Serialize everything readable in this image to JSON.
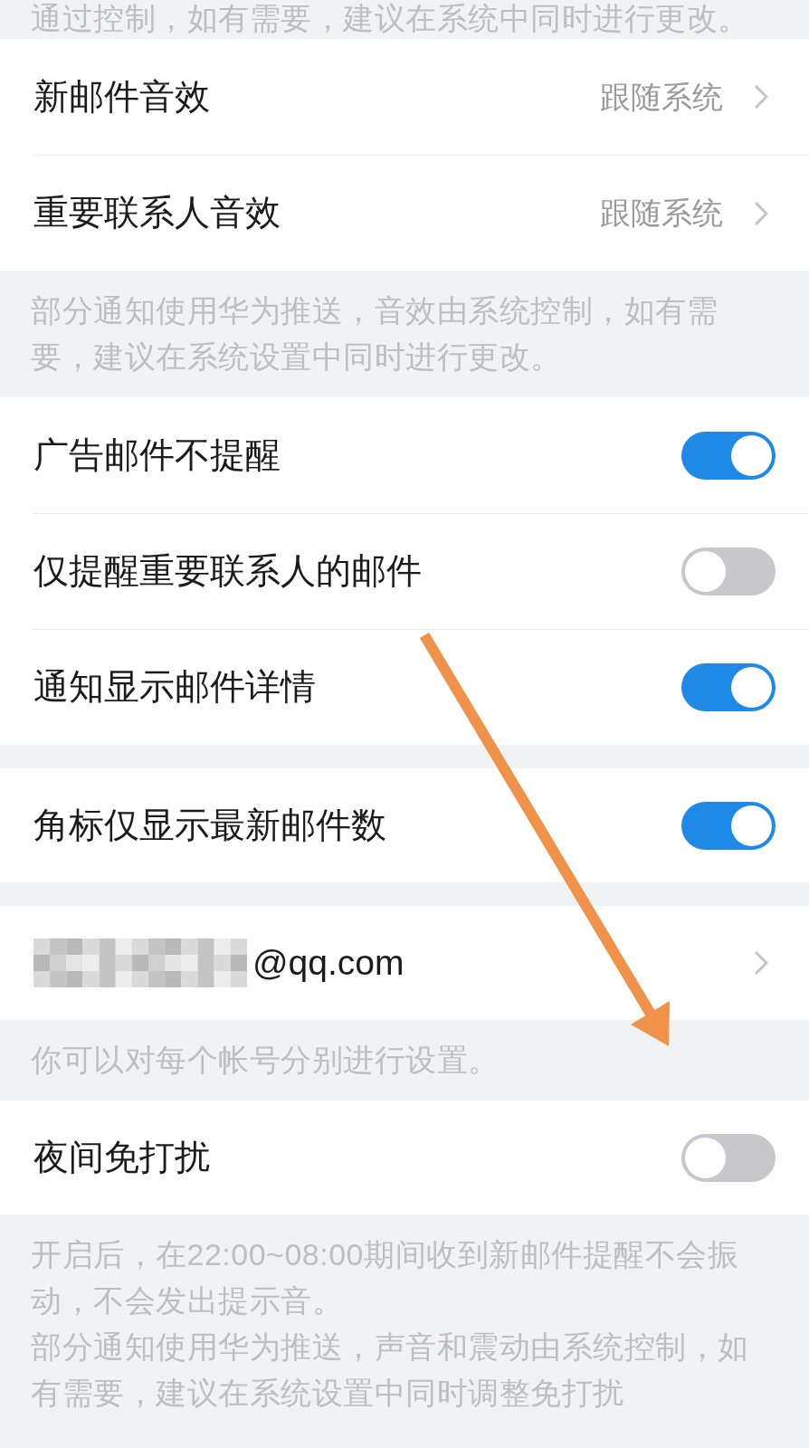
{
  "top_note": "通过控制，如有需要，建议在系统中同时进行更改。",
  "sections": [
    {
      "items": [
        {
          "kind": "link",
          "label": "新邮件音效",
          "value": "跟随系统"
        },
        {
          "kind": "link",
          "label": "重要联系人音效",
          "value": "跟随系统"
        }
      ],
      "footer": [
        "部分通知使用华为推送，音效由系统控制，如有需要，建议在系统设置中同时进行更改。"
      ]
    },
    {
      "items": [
        {
          "kind": "toggle",
          "label": "广告邮件不提醒",
          "on": true
        },
        {
          "kind": "toggle",
          "label": "仅提醒重要联系人的邮件",
          "on": false
        },
        {
          "kind": "toggle",
          "label": "通知显示邮件详情",
          "on": true
        }
      ]
    },
    {
      "items": [
        {
          "kind": "toggle",
          "label": "角标仅显示最新邮件数",
          "on": true
        }
      ]
    },
    {
      "items": [
        {
          "kind": "account",
          "label": "@qq.com",
          "redacted": true
        }
      ],
      "footer": [
        "你可以对每个帐号分别进行设置。"
      ]
    },
    {
      "items": [
        {
          "kind": "toggle",
          "label": "夜间免打扰",
          "on": false
        }
      ],
      "footer": [
        "开启后，在22:00~08:00期间收到新邮件提醒不会振动，不会发出提示音。",
        "部分通知使用华为推送，声音和震动由系统控制，如有需要，建议在系统设置中同时调整免打扰"
      ]
    }
  ]
}
